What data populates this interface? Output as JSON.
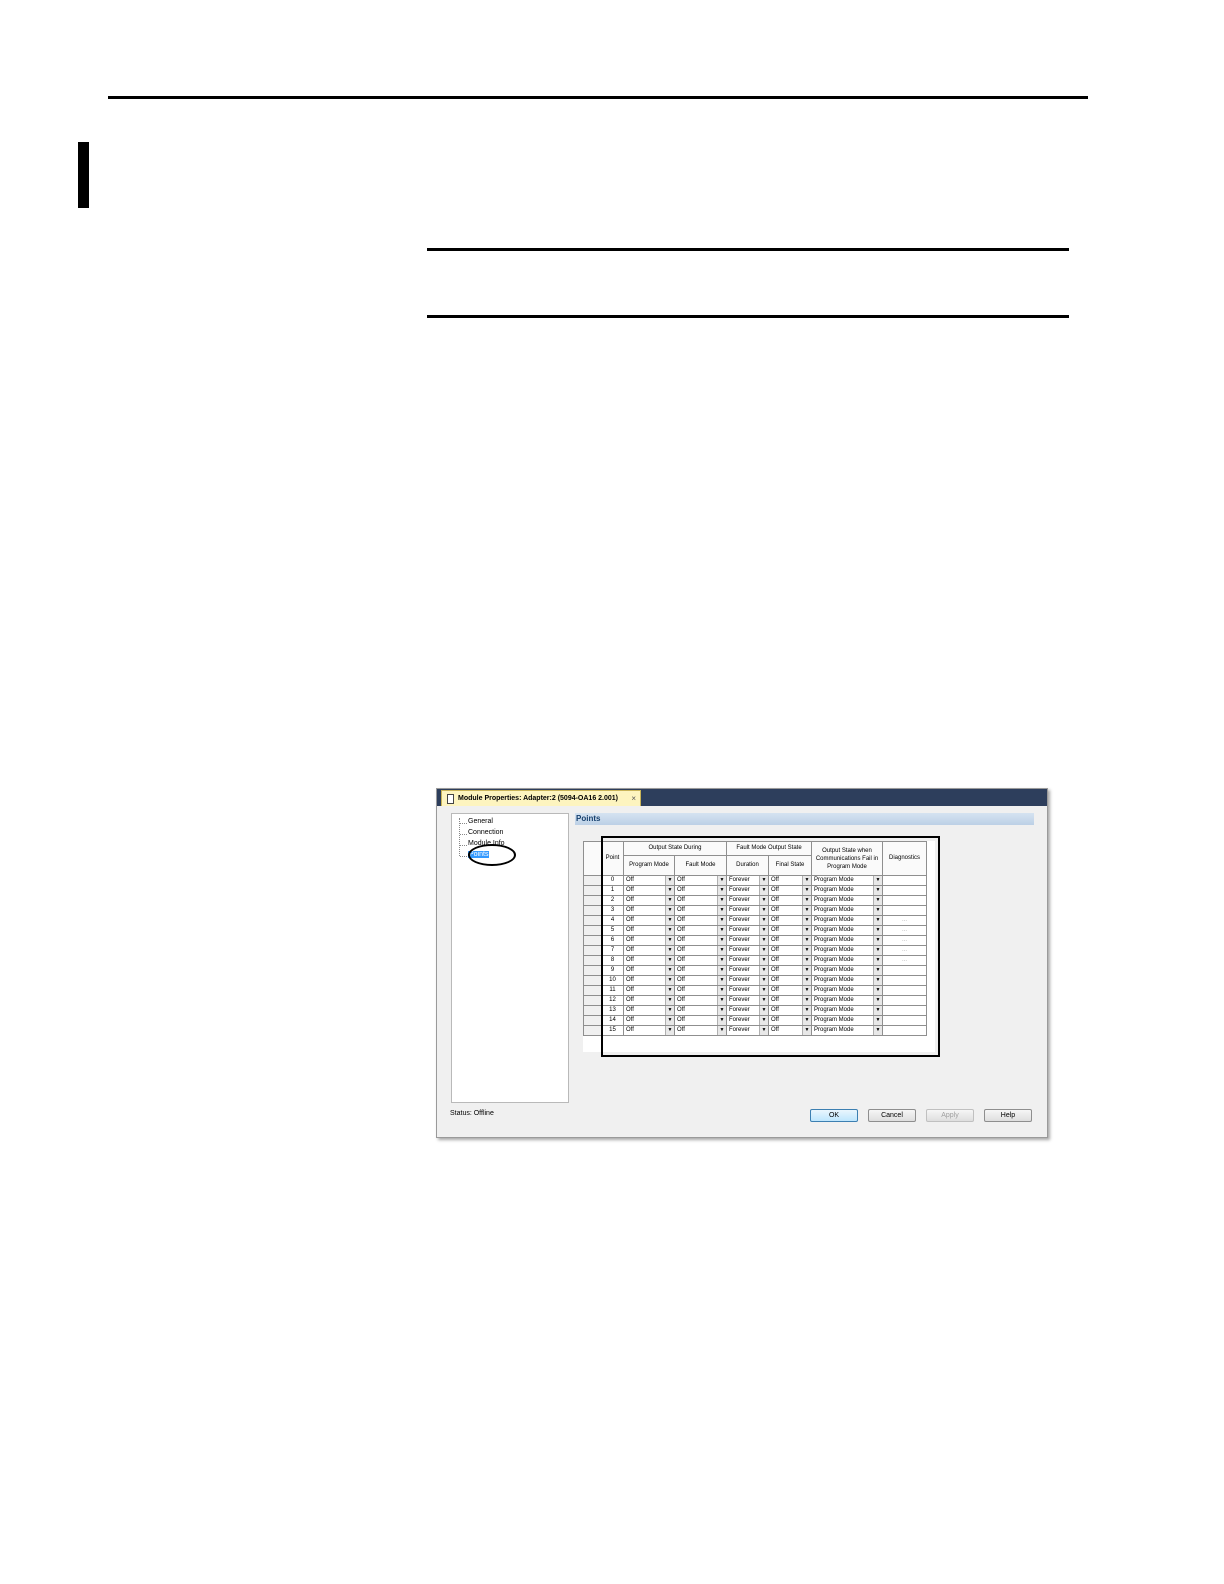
{
  "dialog": {
    "tab_title": "Module Properties: Adapter:2 (5094-OA16 2.001)",
    "tab_close": "×",
    "nav": {
      "items": [
        "General",
        "Connection",
        "Module Info",
        "Points"
      ],
      "selected": "Points"
    },
    "section_title": "Points",
    "grid": {
      "headers": {
        "point": "Point",
        "output_state_during": "Output State During",
        "program_mode": "Program Mode",
        "fault_mode": "Fault Mode",
        "fault_mode_output_state": "Fault Mode Output State",
        "duration": "Duration",
        "final_state": "Final State",
        "comm_fail": "Output State when Communications Fail in Program Mode",
        "diagnostics": "Diagnostics"
      },
      "rows": [
        {
          "point": "0",
          "program_mode": "Off",
          "fault_mode": "Off",
          "duration": "Forever",
          "final_state": "Off",
          "comm_fail": "Program Mode",
          "diagnostics": ""
        },
        {
          "point": "1",
          "program_mode": "Off",
          "fault_mode": "Off",
          "duration": "Forever",
          "final_state": "Off",
          "comm_fail": "Program Mode",
          "diagnostics": ""
        },
        {
          "point": "2",
          "program_mode": "Off",
          "fault_mode": "Off",
          "duration": "Forever",
          "final_state": "Off",
          "comm_fail": "Program Mode",
          "diagnostics": ""
        },
        {
          "point": "3",
          "program_mode": "Off",
          "fault_mode": "Off",
          "duration": "Forever",
          "final_state": "Off",
          "comm_fail": "Program Mode",
          "diagnostics": ""
        },
        {
          "point": "4",
          "program_mode": "Off",
          "fault_mode": "Off",
          "duration": "Forever",
          "final_state": "Off",
          "comm_fail": "Program Mode",
          "diagnostics": "..."
        },
        {
          "point": "5",
          "program_mode": "Off",
          "fault_mode": "Off",
          "duration": "Forever",
          "final_state": "Off",
          "comm_fail": "Program Mode",
          "diagnostics": "..."
        },
        {
          "point": "6",
          "program_mode": "Off",
          "fault_mode": "Off",
          "duration": "Forever",
          "final_state": "Off",
          "comm_fail": "Program Mode",
          "diagnostics": "..."
        },
        {
          "point": "7",
          "program_mode": "Off",
          "fault_mode": "Off",
          "duration": "Forever",
          "final_state": "Off",
          "comm_fail": "Program Mode",
          "diagnostics": "..."
        },
        {
          "point": "8",
          "program_mode": "Off",
          "fault_mode": "Off",
          "duration": "Forever",
          "final_state": "Off",
          "comm_fail": "Program Mode",
          "diagnostics": "..."
        },
        {
          "point": "9",
          "program_mode": "Off",
          "fault_mode": "Off",
          "duration": "Forever",
          "final_state": "Off",
          "comm_fail": "Program Mode",
          "diagnostics": ""
        },
        {
          "point": "10",
          "program_mode": "Off",
          "fault_mode": "Off",
          "duration": "Forever",
          "final_state": "Off",
          "comm_fail": "Program Mode",
          "diagnostics": ""
        },
        {
          "point": "11",
          "program_mode": "Off",
          "fault_mode": "Off",
          "duration": "Forever",
          "final_state": "Off",
          "comm_fail": "Program Mode",
          "diagnostics": ""
        },
        {
          "point": "12",
          "program_mode": "Off",
          "fault_mode": "Off",
          "duration": "Forever",
          "final_state": "Off",
          "comm_fail": "Program Mode",
          "diagnostics": ""
        },
        {
          "point": "13",
          "program_mode": "Off",
          "fault_mode": "Off",
          "duration": "Forever",
          "final_state": "Off",
          "comm_fail": "Program Mode",
          "diagnostics": ""
        },
        {
          "point": "14",
          "program_mode": "Off",
          "fault_mode": "Off",
          "duration": "Forever",
          "final_state": "Off",
          "comm_fail": "Program Mode",
          "diagnostics": ""
        },
        {
          "point": "15",
          "program_mode": "Off",
          "fault_mode": "Off",
          "duration": "Forever",
          "final_state": "Off",
          "comm_fail": "Program Mode",
          "diagnostics": ""
        }
      ]
    },
    "status": "Status:  Offline",
    "buttons": {
      "ok": "OK",
      "cancel": "Cancel",
      "apply": "Apply",
      "help": "Help"
    }
  }
}
